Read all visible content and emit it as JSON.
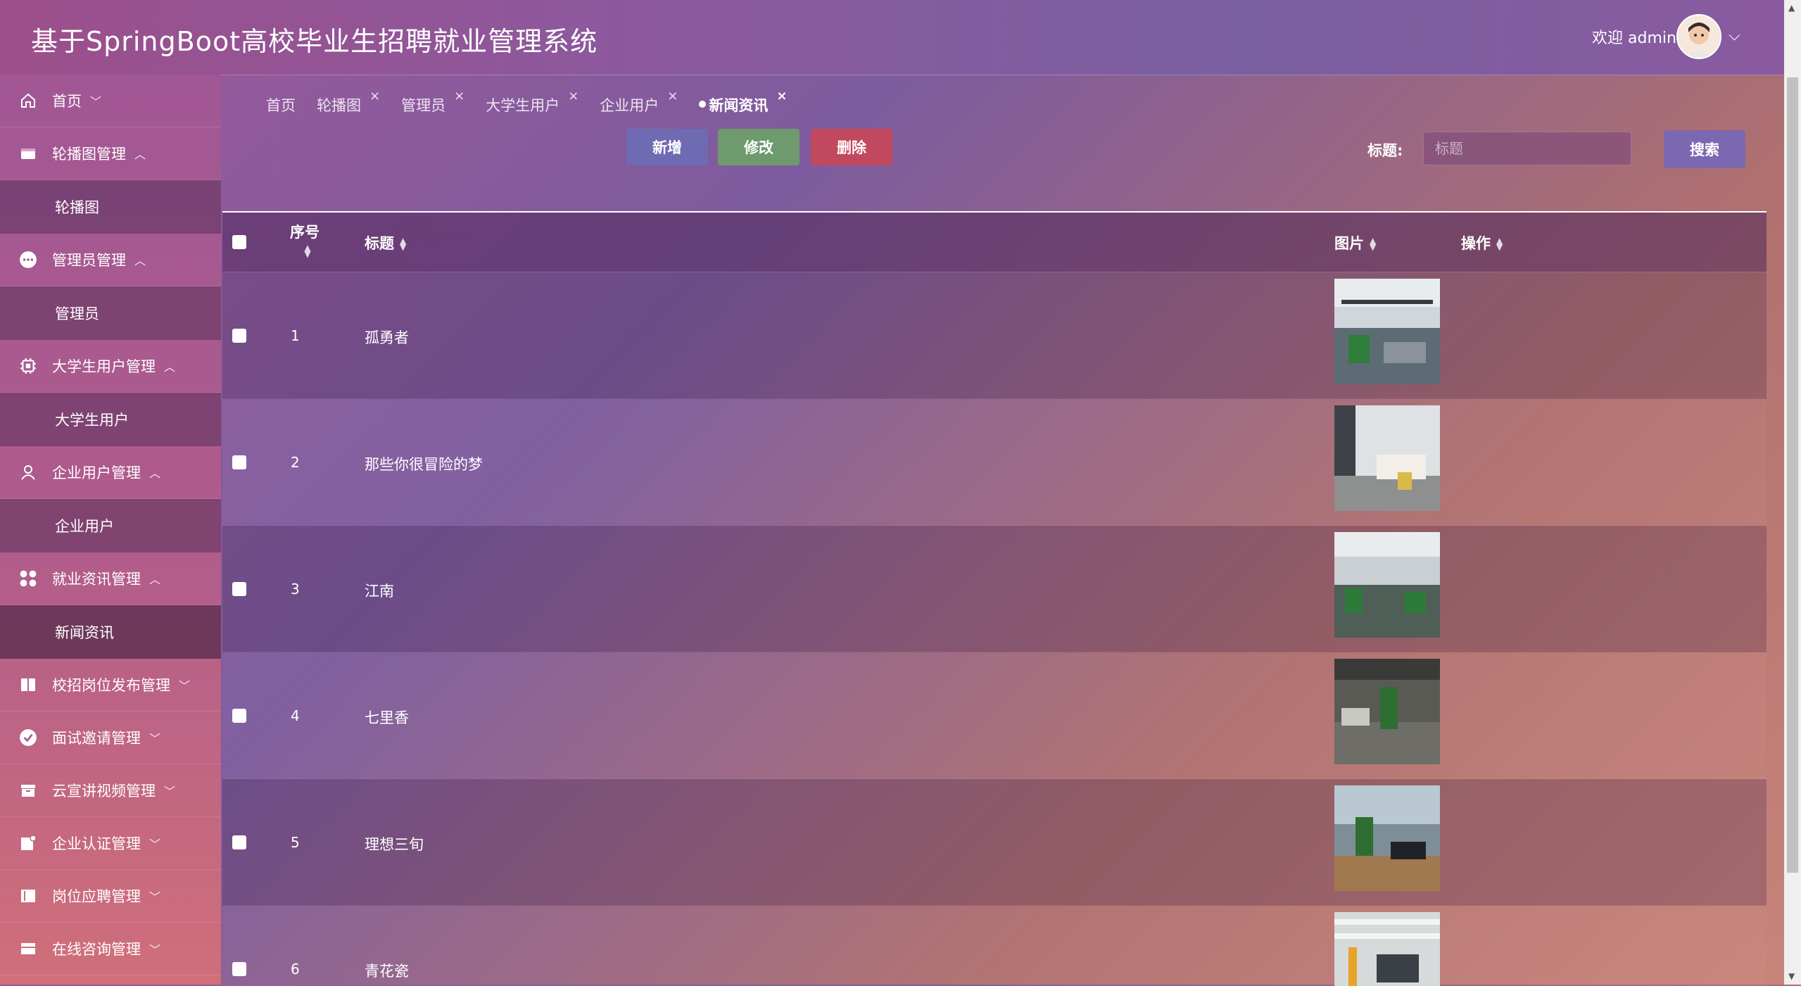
{
  "header": {
    "title": "基于SpringBoot高校毕业生招聘就业管理系统",
    "welcome": "欢迎 admin"
  },
  "sidebar": {
    "items": [
      {
        "label": "首页",
        "icon": "home-icon",
        "caret": "﹀"
      },
      {
        "label": "轮播图管理",
        "icon": "carousel-icon",
        "caret": "︿",
        "sub": "轮播图"
      },
      {
        "label": "管理员管理",
        "icon": "admin-icon",
        "caret": "︿",
        "sub": "管理员"
      },
      {
        "label": "大学生用户管理",
        "icon": "chip-icon",
        "caret": "︿",
        "sub": "大学生用户"
      },
      {
        "label": "企业用户管理",
        "icon": "user-icon",
        "caret": "︿",
        "sub": "企业用户"
      },
      {
        "label": "就业资讯管理",
        "icon": "grid-icon",
        "caret": "︿",
        "sub": "新闻资讯"
      },
      {
        "label": "校招岗位发布管理",
        "icon": "book-icon",
        "caret": "﹀"
      },
      {
        "label": "面试邀请管理",
        "icon": "check-circle-icon",
        "caret": "﹀"
      },
      {
        "label": "云宣讲视频管理",
        "icon": "archive-icon",
        "caret": "﹀"
      },
      {
        "label": "企业认证管理",
        "icon": "badge-icon",
        "caret": "﹀"
      },
      {
        "label": "岗位应聘管理",
        "icon": "panel-icon",
        "caret": "﹀"
      },
      {
        "label": "在线咨询管理",
        "icon": "inbox-icon",
        "caret": "﹀"
      }
    ]
  },
  "tabs": [
    {
      "label": "首页"
    },
    {
      "label": "轮播图",
      "close": "×"
    },
    {
      "label": "管理员",
      "close": "×"
    },
    {
      "label": "大学生用户",
      "close": "×"
    },
    {
      "label": "企业用户",
      "close": "×"
    },
    {
      "label": "新闻资讯",
      "close": "×",
      "active": true
    }
  ],
  "toolbar": {
    "add": "新增",
    "edit": "修改",
    "delete": "删除",
    "search_label": "标题:",
    "search_placeholder": "标题",
    "search_button": "搜索"
  },
  "table": {
    "headers": {
      "index": "序号",
      "title": "标题",
      "image": "图片",
      "action": "操作"
    },
    "rows": [
      {
        "index": "1",
        "title": "孤勇者"
      },
      {
        "index": "2",
        "title": "那些你很冒险的梦"
      },
      {
        "index": "3",
        "title": "江南"
      },
      {
        "index": "4",
        "title": "七里香"
      },
      {
        "index": "5",
        "title": "理想三旬"
      },
      {
        "index": "6",
        "title": "青花瓷"
      }
    ]
  },
  "colors": {
    "add": "#6f6bb3",
    "edit": "#6f9a6e",
    "delete": "#c2485e",
    "search": "#7b68b0"
  }
}
